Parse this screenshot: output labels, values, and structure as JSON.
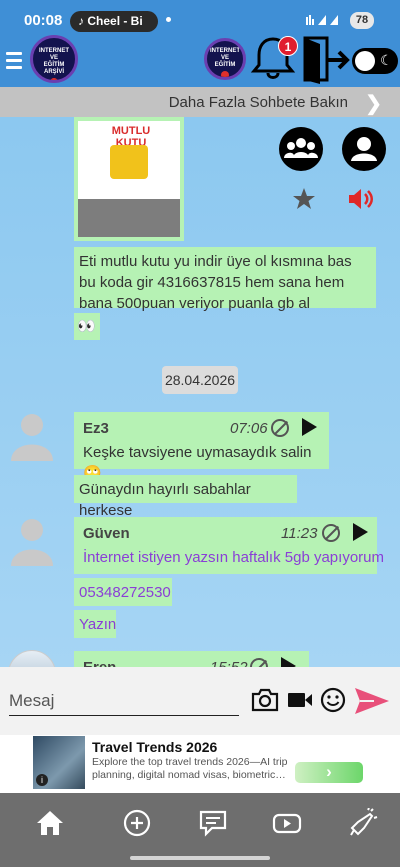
{
  "status_bar": {
    "time": "00:08",
    "app_pill": "Cheel - Bi",
    "battery": "78"
  },
  "header": {
    "logo_text": [
      "INTERNET",
      "VE",
      "EĞİTİM",
      "ARŞİVİ"
    ],
    "notification_count": "1",
    "dark_mode": "☾"
  },
  "more_chats": {
    "label": "Daha Fazla Sohbete Bakın"
  },
  "chat": {
    "image_caption": [
      "MUTLU",
      "KUTU"
    ],
    "messages": [
      {
        "text": "Eti mutlu kutu yu indir üye ol kısmına bas bu koda gir 4316637815 hem sana hem bana 500puan veriyor puanla gb al"
      },
      {
        "text": "👀"
      }
    ],
    "date_separator": "28.04.2026",
    "groups": [
      {
        "sender": "Ez3",
        "time": "07:06",
        "messages": [
          "Keşke tavsiyene uymasaydık salin 🙄",
          "Günaydın hayırlı sabahlar herkese"
        ]
      },
      {
        "sender": "Güven",
        "time": "11:23",
        "messages": [
          "İnternet istiyen yazsın haftalık 5gb yapıyorum",
          "05348272530",
          "Yazın"
        ]
      },
      {
        "sender": "Eren",
        "time": "15:52",
        "messages": []
      }
    ]
  },
  "input": {
    "placeholder": "Mesaj"
  },
  "ad": {
    "title": "Travel Trends 2026",
    "description": "Explore the top travel trends 2026—AI trip planning, digital nomad visas, biometric…",
    "info": "i",
    "cta": "›"
  },
  "colors": {
    "app_bar": "#3f8fd6",
    "bubble": "#b6f2b4",
    "send": "#e8507a",
    "badge": "#e01e2e"
  }
}
